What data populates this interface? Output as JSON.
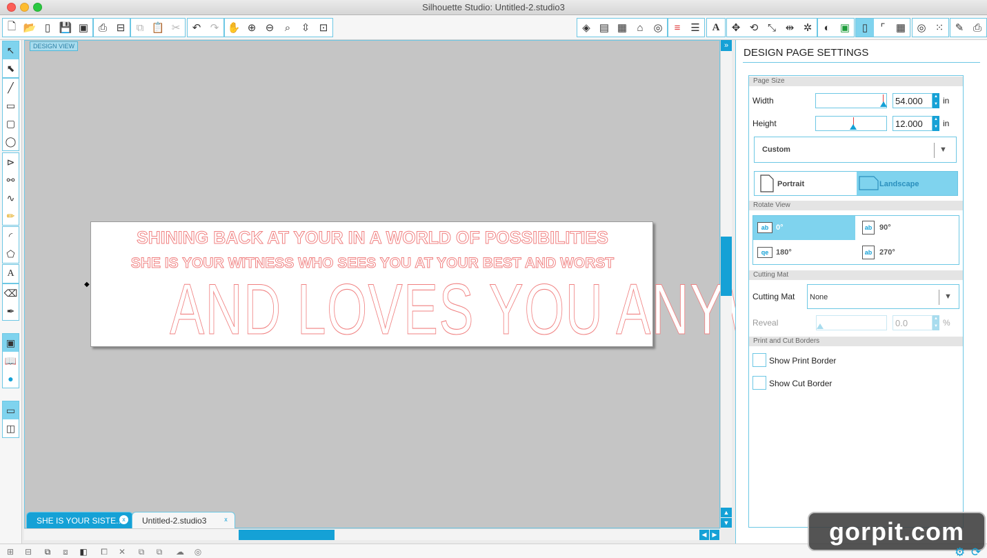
{
  "window": {
    "title": "Silhouette Studio: Untitled-2.studio3"
  },
  "toolbar": {
    "left_icons": [
      "new-doc-icon",
      "open-folder-icon",
      "open-file-icon",
      "save-icon",
      "save-library-icon",
      "print-icon",
      "print-cut-icon",
      "copy-icon",
      "paste-icon",
      "cut-icon",
      "undo-icon",
      "redo-icon",
      "pan-icon",
      "zoom-in-icon",
      "zoom-out-icon",
      "zoom-select-icon",
      "zoom-drag-icon",
      "fit-page-icon"
    ],
    "right_icons": [
      "fill-color-icon",
      "fill-gradient-icon",
      "fill-pattern-icon",
      "line-color-icon",
      "line-style-icon",
      "align-lines-icon",
      "line-thickness-icon",
      "text-style-icon",
      "transform-icon",
      "rotate-icon",
      "scale-icon",
      "move-icon",
      "replicate-icon",
      "modify-icon",
      "offset-icon",
      "page-setup-icon",
      "registration-icon",
      "grid-icon",
      "trace-icon",
      "cut-settings-icon",
      "knife-icon",
      "send-icon"
    ]
  },
  "canvas": {
    "design_view_label": "DESIGN VIEW",
    "text_lines": [
      "SHINING BACK AT YOUR IN A WORLD OF POSSIBILITIES",
      "SHE IS YOUR WITNESS WHO SEES YOU AT YOUR BEST AND WORST",
      "AND LOVES YOU ANYWAY"
    ],
    "cut_line_color": "#f08080"
  },
  "tabs": [
    {
      "label": "SHE IS YOUR SISTE...",
      "active": true
    },
    {
      "label": "Untitled-2.studio3",
      "active": false
    }
  ],
  "panel": {
    "title": "DESIGN PAGE SETTINGS",
    "page_size": {
      "section": "Page Size",
      "width_label": "Width",
      "width_value": "54.000",
      "height_label": "Height",
      "height_value": "12.000",
      "unit": "in",
      "preset": "Custom",
      "portrait_label": "Portrait",
      "landscape_label": "Landscape",
      "orientation": "Landscape"
    },
    "rotate_view": {
      "section": "Rotate View",
      "options": [
        "0°",
        "90°",
        "180°",
        "270°"
      ],
      "selected": "0°"
    },
    "cutting_mat": {
      "section": "Cutting Mat",
      "label": "Cutting Mat",
      "value": "None",
      "reveal_label": "Reveal",
      "reveal_value": "0.0",
      "reveal_unit": "%"
    },
    "borders": {
      "section": "Print and Cut Borders",
      "show_print_border": "Show Print Border",
      "show_cut_border": "Show Cut Border"
    }
  },
  "watermark": "gorpit.com",
  "colors": {
    "accent": "#15a1d6",
    "accent_light": "#7fd3ee",
    "canvas_bg": "#c5c5c5"
  }
}
